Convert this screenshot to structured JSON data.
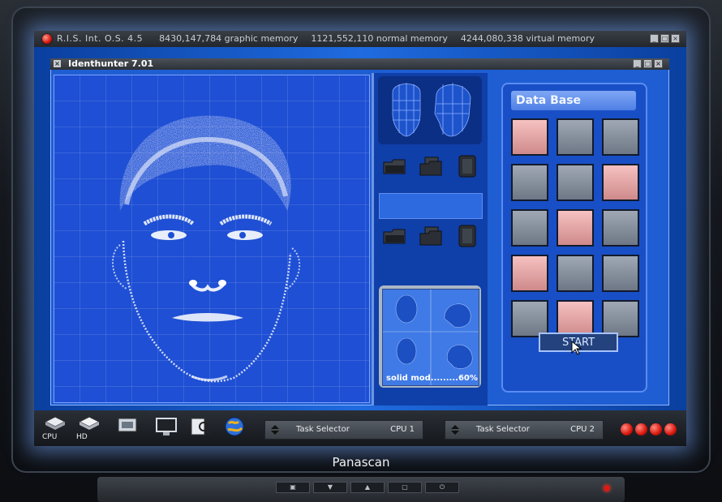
{
  "system": {
    "title": "R.I.S. Int. O.S. 4.5",
    "graphic_memory": "8430,147,784 graphic memory",
    "normal_memory": "1121,552,110 normal memory",
    "virtual_memory": "4244,080,338 virtual memory"
  },
  "app": {
    "title": "Identhunter 7.01"
  },
  "model_preview": {
    "label": "solid mod.........60%"
  },
  "database": {
    "title": "Data Base",
    "start_label": "START"
  },
  "taskbar": {
    "cpu_label": "CPU",
    "hd_label": "HD",
    "selector1": {
      "label": "Task Selector",
      "cpu": "CPU 1"
    },
    "selector2": {
      "label": "Task Selector",
      "cpu": "CPU 2"
    }
  },
  "monitor": {
    "brand": "Panascan"
  },
  "colors": {
    "accent": "#1f5ed2",
    "selected_cell": "#e8a6a6",
    "power_led": "#d61c14"
  }
}
